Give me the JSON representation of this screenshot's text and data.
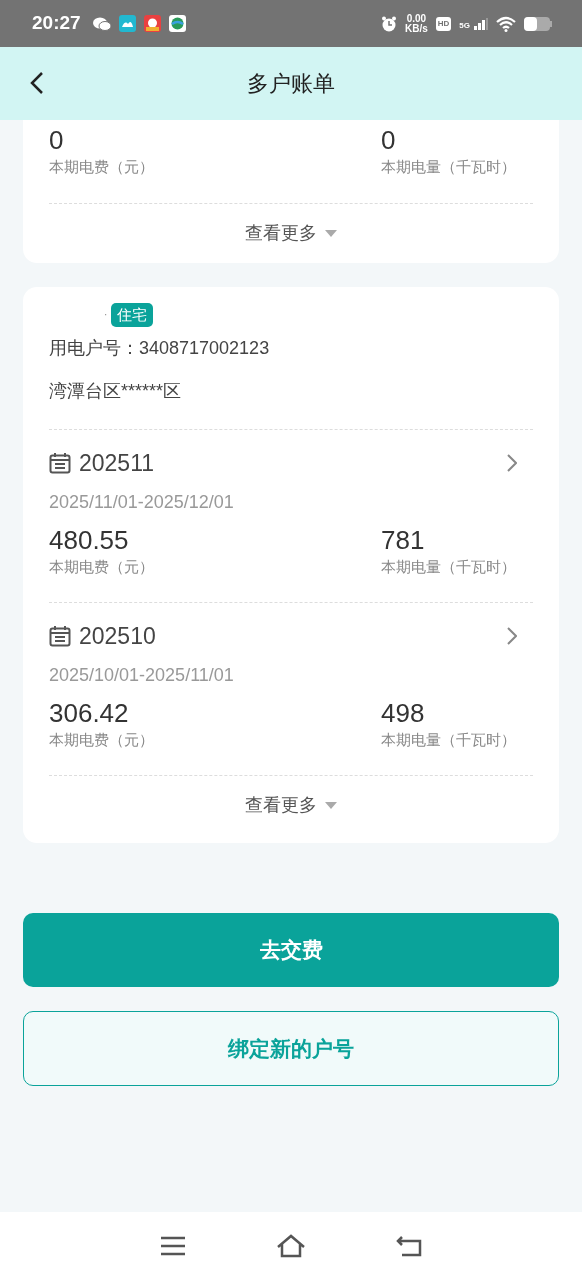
{
  "status_bar": {
    "time": "20:27",
    "speed": "0.00",
    "speed_unit": "KB/s",
    "hd": "HD",
    "network": "5G"
  },
  "header": {
    "title": "多户账单"
  },
  "partial_card": {
    "stats": [
      {
        "value": "0",
        "label": "本期电费（元）"
      },
      {
        "value": "0",
        "label": "本期电量（千瓦时）"
      }
    ],
    "more": "查看更多"
  },
  "account_card": {
    "name": "·",
    "tag": "住宅",
    "account": "用电户号：3408717002123",
    "area": "湾潭台区******区",
    "bills": [
      {
        "period": "202511",
        "range": "2025/11/01-2025/12/01",
        "stats": [
          {
            "value": "480.55",
            "label": "本期电费（元）"
          },
          {
            "value": "781",
            "label": "本期电量（千瓦时）"
          }
        ]
      },
      {
        "period": "202510",
        "range": "2025/10/01-2025/11/01",
        "stats": [
          {
            "value": "306.42",
            "label": "本期电费（元）"
          },
          {
            "value": "498",
            "label": "本期电量（千瓦时）"
          }
        ]
      }
    ],
    "more": "查看更多"
  },
  "buttons": [
    {
      "label": "去交费",
      "kind": "primary"
    },
    {
      "label": "绑定新的户号",
      "kind": "outline"
    }
  ]
}
